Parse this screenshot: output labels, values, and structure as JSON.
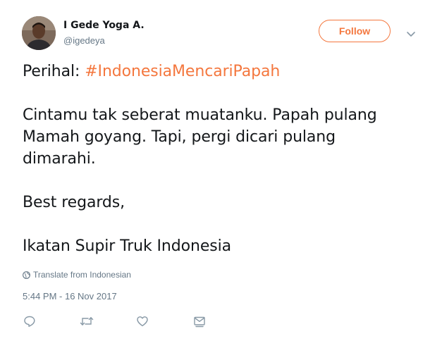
{
  "author": {
    "name": "I Gede Yoga A.",
    "handle": "@igedeya",
    "avatar_icon": "user-avatar"
  },
  "follow_label": "Follow",
  "more_icon": "chevron-down-icon",
  "tweet": {
    "prefix": "Perihal: ",
    "hashtag": "#IndonesiaMencariPapah",
    "lines": [
      "Cintamu tak seberat muatanku. Papah pulang",
      "Mamah goyang. Tapi, pergi dicari pulang",
      "dimarahi."
    ],
    "closing": "Best regards,",
    "signature": "Ikatan Supir Truk Indonesia"
  },
  "translate_label": "Translate from Indonesian",
  "timestamp": "5:44 PM - 16 Nov 2017",
  "actions": [
    "reply-icon",
    "retweet-icon",
    "like-icon",
    "direct-message-icon"
  ],
  "colors": {
    "accent": "#f4773e",
    "text": "#14171a",
    "secondary": "#657786",
    "icon": "#8899a6"
  }
}
